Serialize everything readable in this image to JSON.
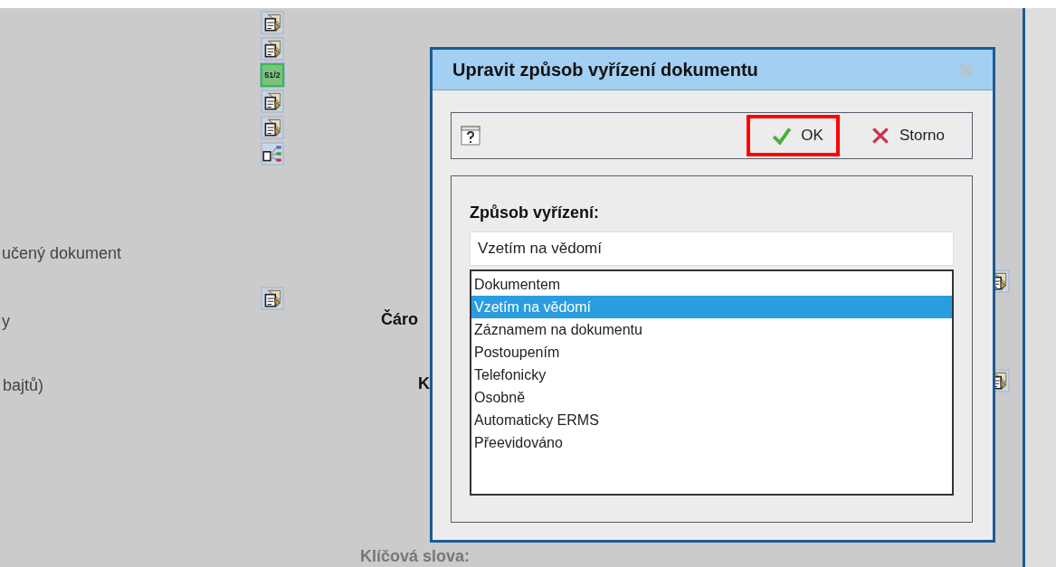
{
  "background": {
    "icons": [
      {
        "kind": "document"
      },
      {
        "kind": "document"
      },
      {
        "kind": "counter",
        "text": "51/2"
      },
      {
        "kind": "document"
      },
      {
        "kind": "document"
      },
      {
        "kind": "tree"
      }
    ],
    "texts": [
      "učený dokument",
      "y",
      "bajtů)"
    ],
    "extra_icon": {
      "kind": "document"
    },
    "labels": [
      "Čáro",
      "K"
    ],
    "bottom_label": "Klíčová slova:"
  },
  "dialog": {
    "title": "Upravit způsob vyřízení dokumentu",
    "close_disabled": true,
    "buttons": [
      {
        "label": "OK",
        "kind": "ok",
        "highlighted": true
      },
      {
        "label": "Storno",
        "kind": "cancel",
        "highlighted": false
      }
    ],
    "field_label": "Způsob vyřízení:",
    "value": "Vzetím na vědomí",
    "options": [
      {
        "label": "Dokumentem",
        "selected": false
      },
      {
        "label": "Vzetím na vědomí",
        "selected": true
      },
      {
        "label": "Záznamem na dokumentu",
        "selected": false
      },
      {
        "label": "Postoupením",
        "selected": false
      },
      {
        "label": "Telefonicky",
        "selected": false
      },
      {
        "label": "Osobně",
        "selected": false
      },
      {
        "label": "Automaticky ERMS",
        "selected": false
      },
      {
        "label": "Přeevidováno",
        "selected": false
      }
    ]
  }
}
